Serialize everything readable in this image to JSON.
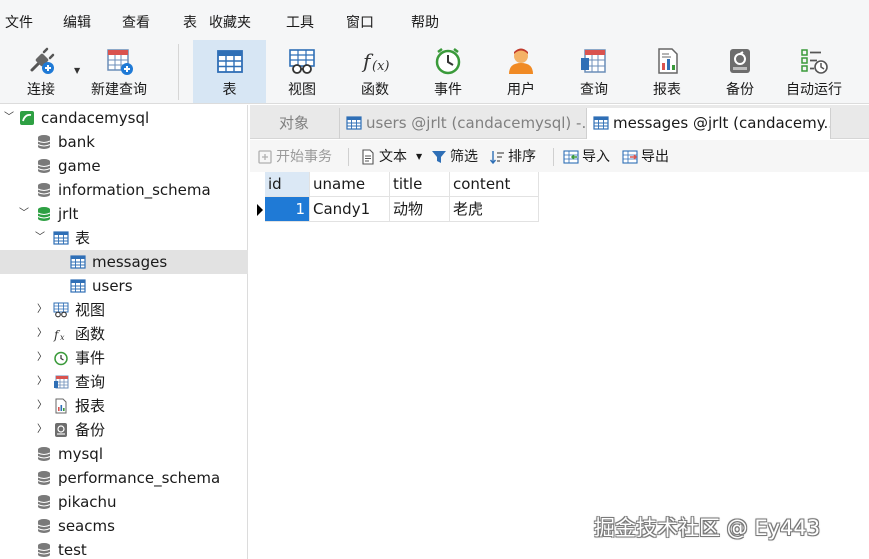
{
  "menu": [
    "文件",
    "编辑",
    "查看",
    "表",
    "收藏夹",
    "工具",
    "窗口",
    "帮助"
  ],
  "toolbar": {
    "connect": "连接",
    "new_query": "新建查询",
    "table": "表",
    "view": "视图",
    "function": "函数",
    "event": "事件",
    "user": "用户",
    "query": "查询",
    "report": "报表",
    "backup": "备份",
    "automation": "自动运行"
  },
  "sidebar": {
    "connection": "candacemysql",
    "databases": [
      "bank",
      "game",
      "information_schema",
      "jrlt",
      "mysql",
      "performance_schema",
      "pikachu",
      "seacms",
      "test"
    ],
    "jrlt_children": {
      "tables_group": "表",
      "tables": [
        "messages",
        "users"
      ],
      "views": "视图",
      "functions": "函数",
      "events": "事件",
      "queries": "查询",
      "reports": "报表",
      "backups": "备份"
    }
  },
  "tabs": {
    "objects": "对象",
    "users_tab": "users @jrlt (candacemysql) -...",
    "messages_tab": "messages @jrlt (candacemy..."
  },
  "subtoolbar": {
    "begin_transaction": "开始事务",
    "text": "文本",
    "filter": "筛选",
    "sort": "排序",
    "import": "导入",
    "export": "导出"
  },
  "grid": {
    "columns": [
      "id",
      "uname",
      "title",
      "content"
    ],
    "rows": [
      [
        "1",
        "Candy1",
        "动物",
        "老虎"
      ]
    ]
  },
  "watermark": "掘金技术社区 @ Ey443",
  "colors": {
    "selection_blue": "#1f7ad6",
    "toolbar_active": "#d7e6f4",
    "db_icon_green": "#2ea043"
  }
}
